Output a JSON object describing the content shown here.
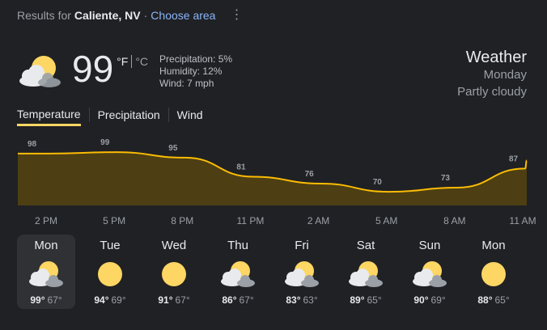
{
  "header": {
    "results_prefix": "Results for",
    "location": "Caliente, NV",
    "separator": "·",
    "choose_area": "Choose area",
    "more_menu": "⋮"
  },
  "current": {
    "icon": "partly-cloudy-icon",
    "temperature": "99",
    "unit_f": "°F",
    "unit_c": "°C",
    "precipitation": "Precipitation: 5%",
    "humidity": "Humidity: 12%",
    "wind": "Wind: 7 mph"
  },
  "summary": {
    "title": "Weather",
    "day": "Monday",
    "condition": "Partly cloudy"
  },
  "tabs": [
    {
      "label": "Temperature",
      "active": true
    },
    {
      "label": "Precipitation",
      "active": false
    },
    {
      "label": "Wind",
      "active": false
    }
  ],
  "colors": {
    "background": "#202124",
    "chart_line": "#fbbc04",
    "chart_fill": "#4d3f13",
    "tab_underline": "#fdd663",
    "link": "#8ab4f8",
    "sun": "#fdd663"
  },
  "chart_data": {
    "type": "area",
    "x": [
      "2 PM",
      "5 PM",
      "8 PM",
      "11 PM",
      "2 AM",
      "5 AM",
      "8 AM",
      "11 AM"
    ],
    "values": [
      98,
      99,
      95,
      81,
      76,
      70,
      73,
      87
    ],
    "ylim": [
      60,
      105
    ]
  },
  "forecast": [
    {
      "day": "Mon",
      "icon": "partly-cloudy-icon",
      "hi": "99°",
      "lo": "67°",
      "selected": true
    },
    {
      "day": "Tue",
      "icon": "sunny-icon",
      "hi": "94°",
      "lo": "69°",
      "selected": false
    },
    {
      "day": "Wed",
      "icon": "sunny-icon",
      "hi": "91°",
      "lo": "67°",
      "selected": false
    },
    {
      "day": "Thu",
      "icon": "partly-cloudy-icon",
      "hi": "86°",
      "lo": "67°",
      "selected": false
    },
    {
      "day": "Fri",
      "icon": "partly-cloudy-icon",
      "hi": "83°",
      "lo": "63°",
      "selected": false
    },
    {
      "day": "Sat",
      "icon": "partly-cloudy-icon",
      "hi": "89°",
      "lo": "65°",
      "selected": false
    },
    {
      "day": "Sun",
      "icon": "partly-cloudy-icon",
      "hi": "90°",
      "lo": "69°",
      "selected": false
    },
    {
      "day": "Mon",
      "icon": "sunny-icon",
      "hi": "88°",
      "lo": "65°",
      "selected": false
    }
  ]
}
